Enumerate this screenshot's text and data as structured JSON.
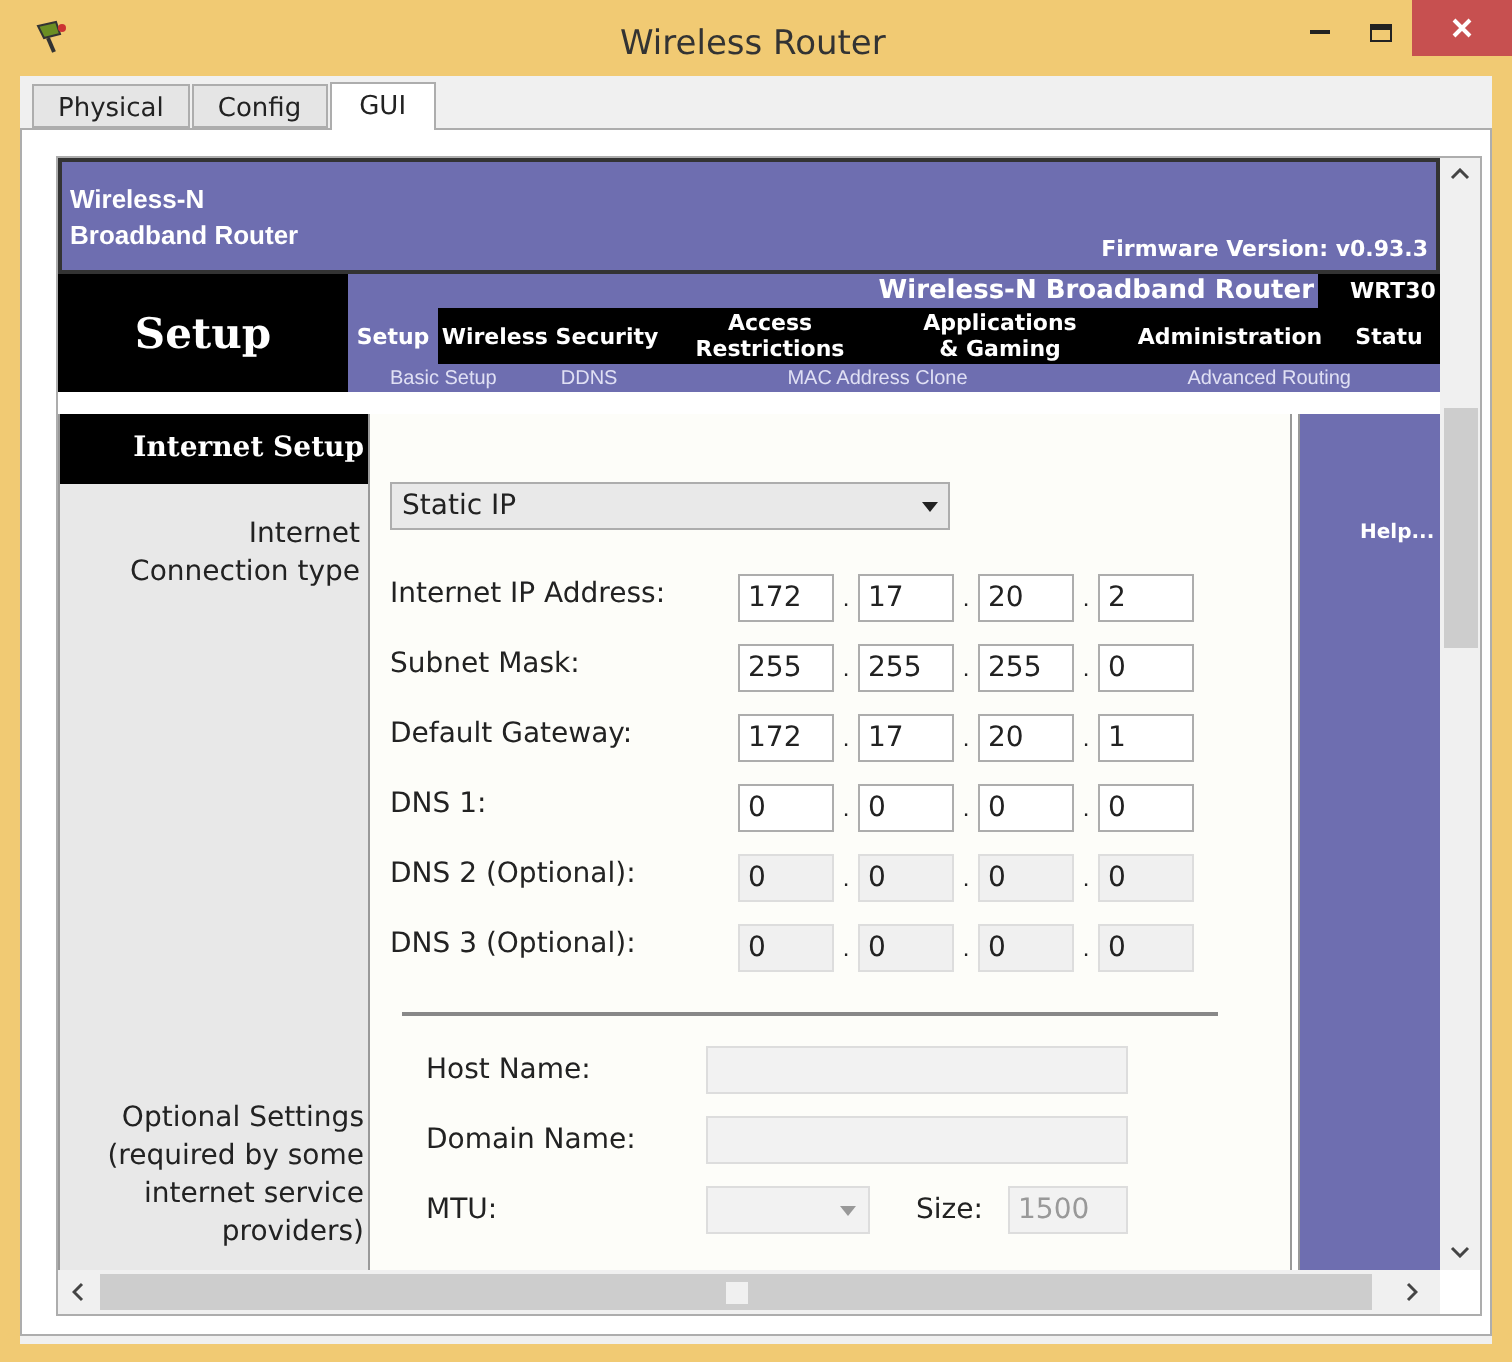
{
  "window": {
    "title": "Wireless Router"
  },
  "tabs": [
    {
      "label": "Physical",
      "selected": false
    },
    {
      "label": "Config",
      "selected": false
    },
    {
      "label": "GUI",
      "selected": true
    }
  ],
  "router_page": {
    "brand_lines": [
      "Wireless-N",
      "Broadband Router"
    ],
    "firmware": "Firmware Version: v0.93.3",
    "section": "Setup",
    "product_name": "Wireless-N Broadband Router",
    "model": "WRT30",
    "nav": [
      {
        "label": "Setup",
        "selected": true
      },
      {
        "label": "Wireless Security",
        "selected": false
      },
      {
        "label": "Access Restrictions",
        "selected": false
      },
      {
        "label": "Applications & Gaming",
        "selected": false
      },
      {
        "label": "Administration",
        "selected": false
      },
      {
        "label": "Statu",
        "selected": false
      }
    ],
    "subnav": [
      "Basic Setup",
      "DDNS",
      "MAC Address Clone",
      "Advanced Routing"
    ],
    "sidebar": {
      "heading": "Internet Setup",
      "connection_label": "Internet Connection type",
      "optional_label": "Optional Settings (required by some internet service providers)"
    },
    "connection_type": {
      "value": "Static IP"
    },
    "ip_separators": [
      [
        ".",
        ".",
        "."
      ],
      [
        ".",
        ".",
        "."
      ],
      [
        ".",
        ".",
        "."
      ],
      [
        ".",
        ".",
        "."
      ],
      [
        ".",
        ".",
        "."
      ],
      [
        ".",
        ".",
        "."
      ]
    ],
    "ip_rows": [
      {
        "label": "Internet IP Address:",
        "octets": [
          "172",
          "17",
          "20",
          "2"
        ],
        "disabled": false
      },
      {
        "label": "Subnet Mask:",
        "octets": [
          "255",
          "255",
          "255",
          "0"
        ],
        "disabled": false
      },
      {
        "label": "Default Gateway:",
        "octets": [
          "172",
          "17",
          "20",
          "1"
        ],
        "disabled": false
      },
      {
        "label": "DNS 1:",
        "octets": [
          "0",
          "0",
          "0",
          "0"
        ],
        "disabled": false
      },
      {
        "label": "DNS 2 (Optional):",
        "octets": [
          "0",
          "0",
          "0",
          "0"
        ],
        "disabled": true
      },
      {
        "label": "DNS 3 (Optional):",
        "octets": [
          "0",
          "0",
          "0",
          "0"
        ],
        "disabled": true
      }
    ],
    "host_name": {
      "label": "Host Name:",
      "disabled": true
    },
    "domain_name": {
      "label": "Domain Name:",
      "disabled": true
    },
    "mtu": {
      "label": "MTU:",
      "disabled": true
    },
    "size": {
      "label": "Size:",
      "value": "1500",
      "disabled": true
    },
    "help": "Help..."
  }
}
